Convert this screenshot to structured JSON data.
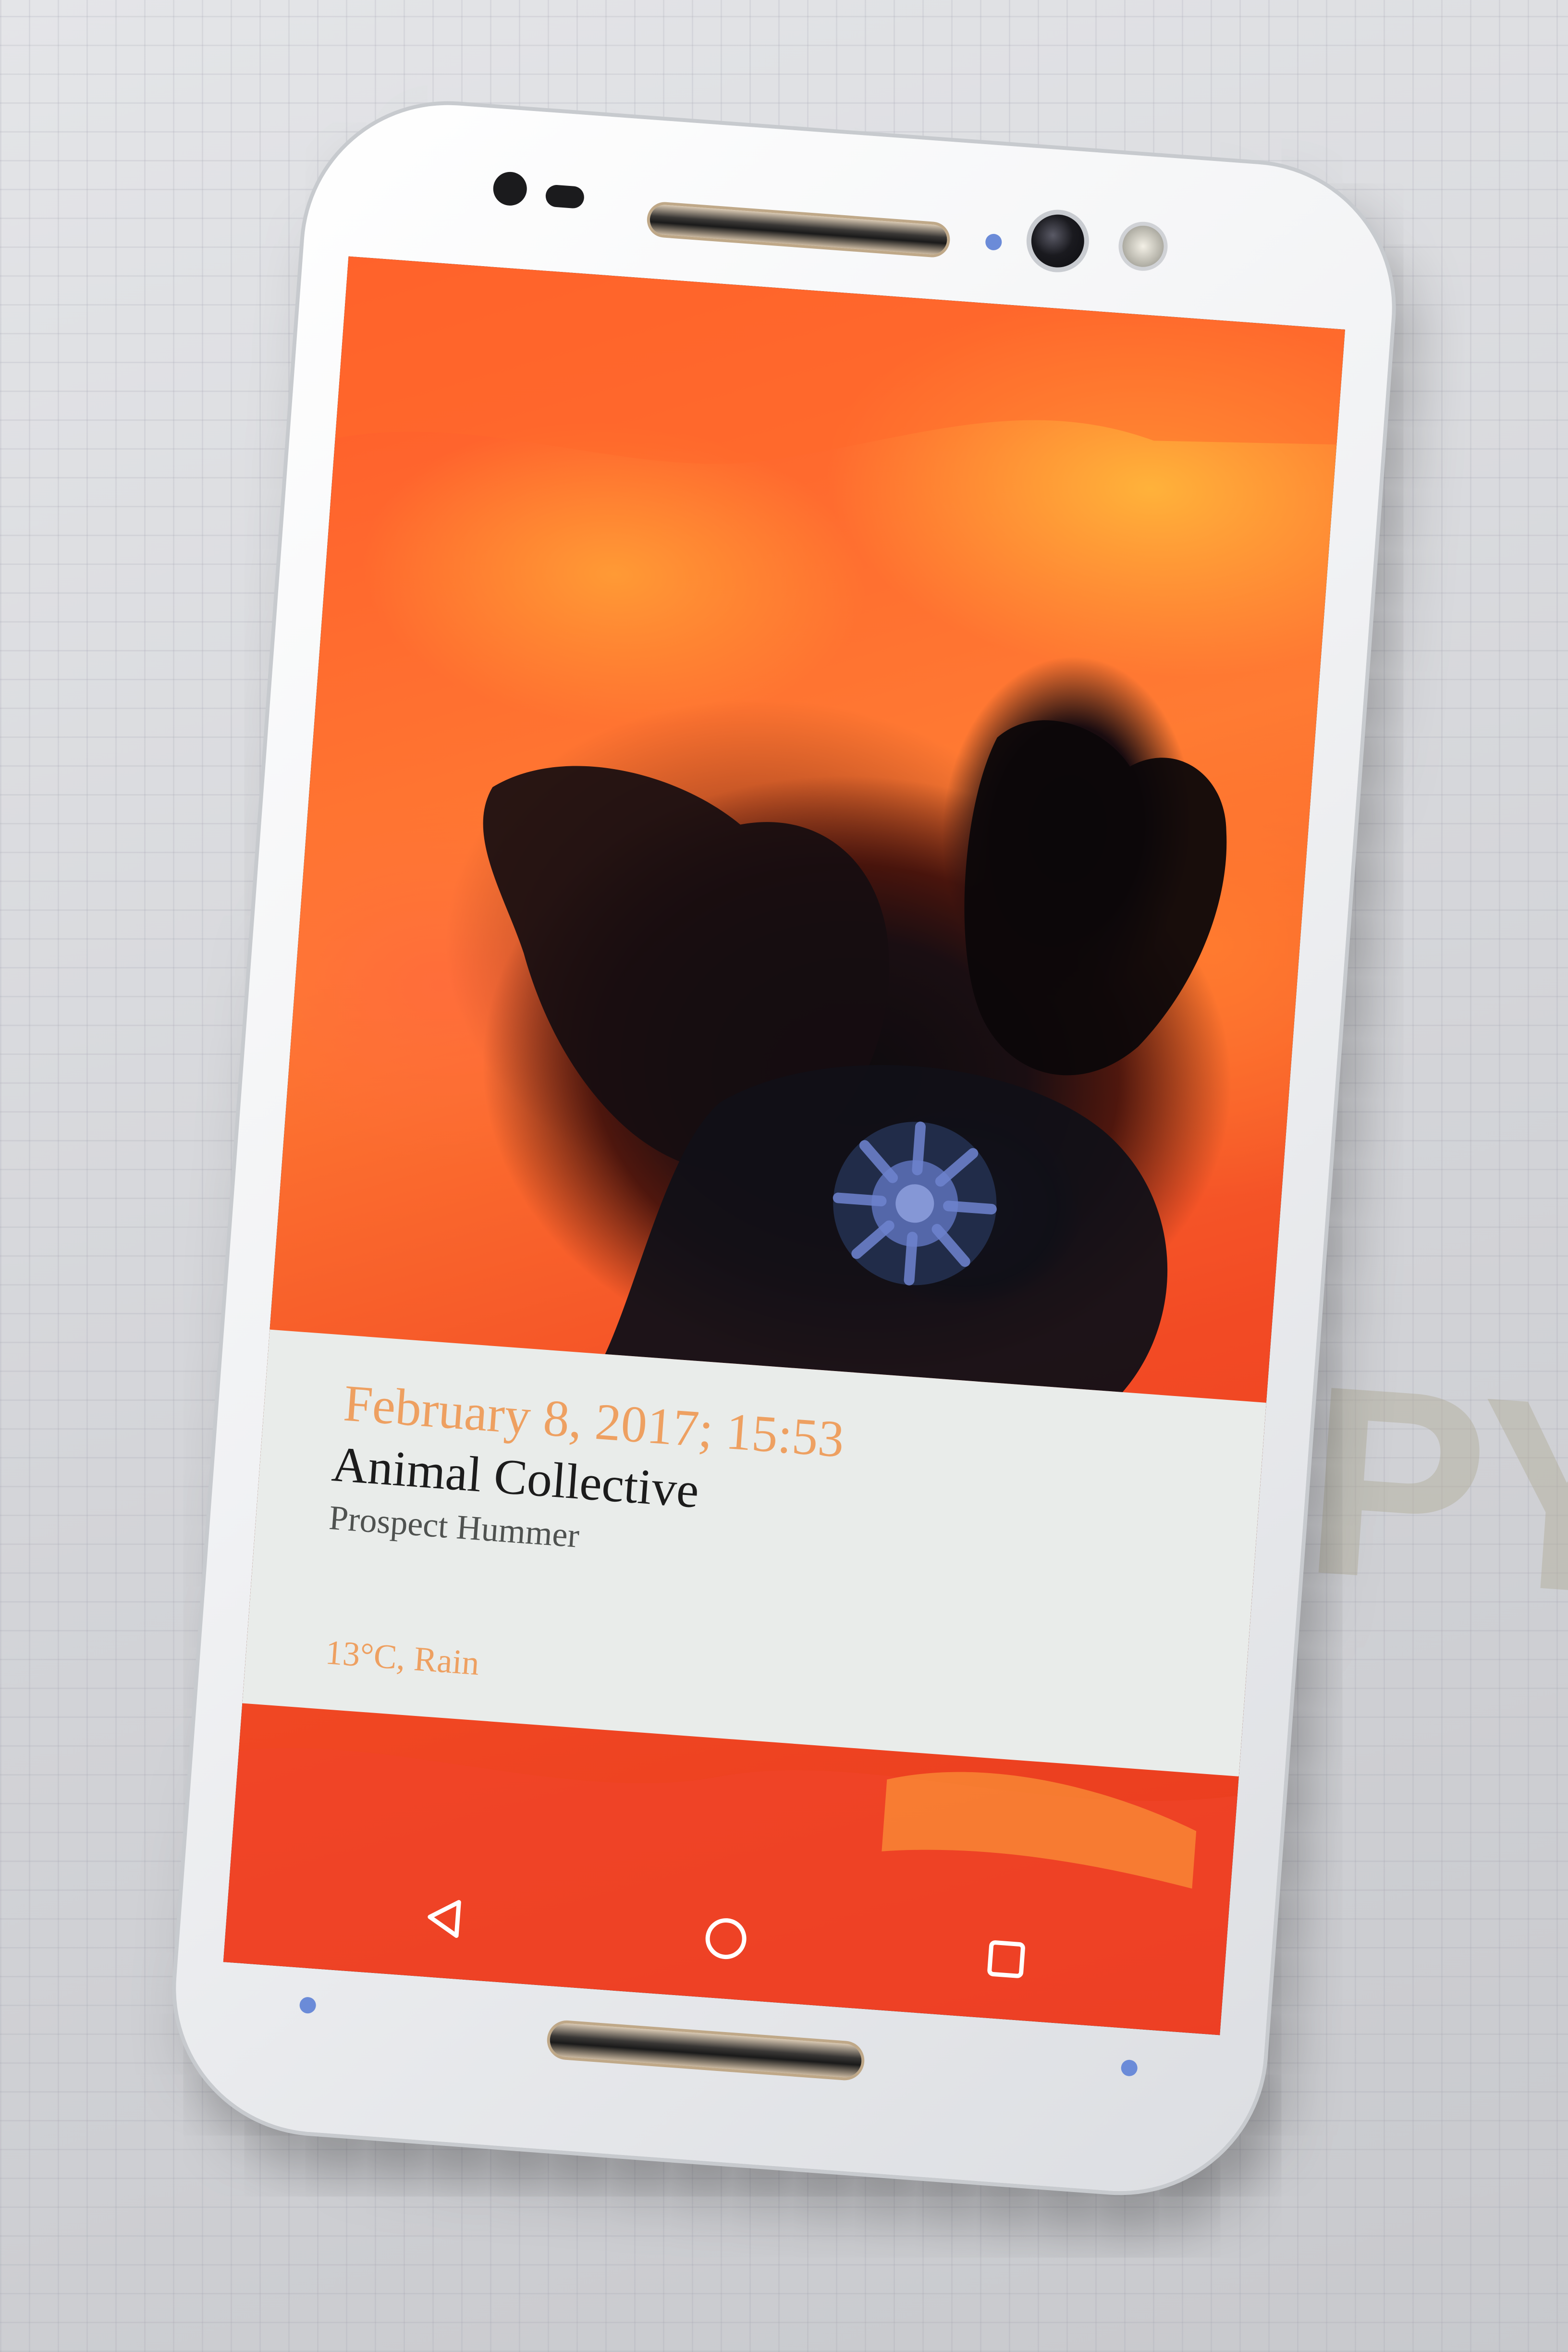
{
  "background": {
    "surface_color": "#d9dadc",
    "paper_print_text": "PY"
  },
  "phone": {
    "body_color": "#f1f2f4",
    "indicator_color": "#6b8bd8"
  },
  "lockscreen": {
    "card_color": "#e9ecea",
    "accent_color": "#eea061",
    "date_time": "February 8, 2017; 15:53",
    "artist": "Animal Collective",
    "track": "Prospect Hummer",
    "weather": "13°C, Rain"
  },
  "navbar": {
    "back_icon": "triangle-back-icon",
    "home_icon": "circle-home-icon",
    "recent_icon": "square-recents-icon"
  }
}
